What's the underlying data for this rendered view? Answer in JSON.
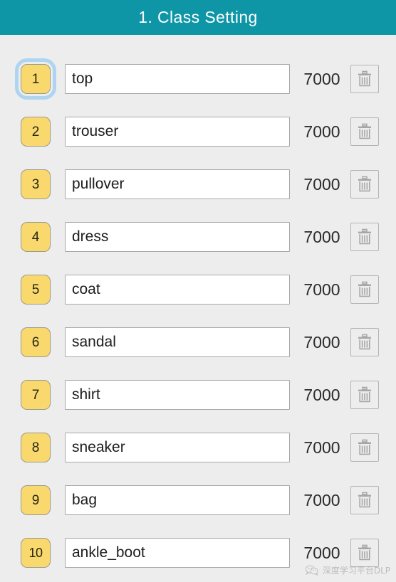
{
  "header": {
    "title": "1. Class Setting",
    "background_color": "#0e96a7",
    "text_color": "#ffffff"
  },
  "theme": {
    "page_background": "#ededed",
    "badge_fill": "#f9d96d",
    "badge_border": "#9b9b8f",
    "focus_ring": "#aed4f0",
    "input_background": "#ffffff",
    "input_border": "#a8a8a8",
    "button_border": "#b4b4b4",
    "count_text": "#2b2b2b"
  },
  "class_list": {
    "focused_row_index": 1,
    "delete_icon": "trash-icon",
    "name_placeholder": "class name",
    "rows": [
      {
        "index": "1",
        "name": "top",
        "count": "7000"
      },
      {
        "index": "2",
        "name": "trouser",
        "count": "7000"
      },
      {
        "index": "3",
        "name": "pullover",
        "count": "7000"
      },
      {
        "index": "4",
        "name": "dress",
        "count": "7000"
      },
      {
        "index": "5",
        "name": "coat",
        "count": "7000"
      },
      {
        "index": "6",
        "name": "sandal",
        "count": "7000"
      },
      {
        "index": "7",
        "name": "shirt",
        "count": "7000"
      },
      {
        "index": "8",
        "name": "sneaker",
        "count": "7000"
      },
      {
        "index": "9",
        "name": "bag",
        "count": "7000"
      },
      {
        "index": "10",
        "name": "ankle_boot",
        "count": "7000"
      }
    ]
  },
  "watermark": {
    "text": "深度学习平台DLP",
    "icon": "wechat-icon"
  }
}
